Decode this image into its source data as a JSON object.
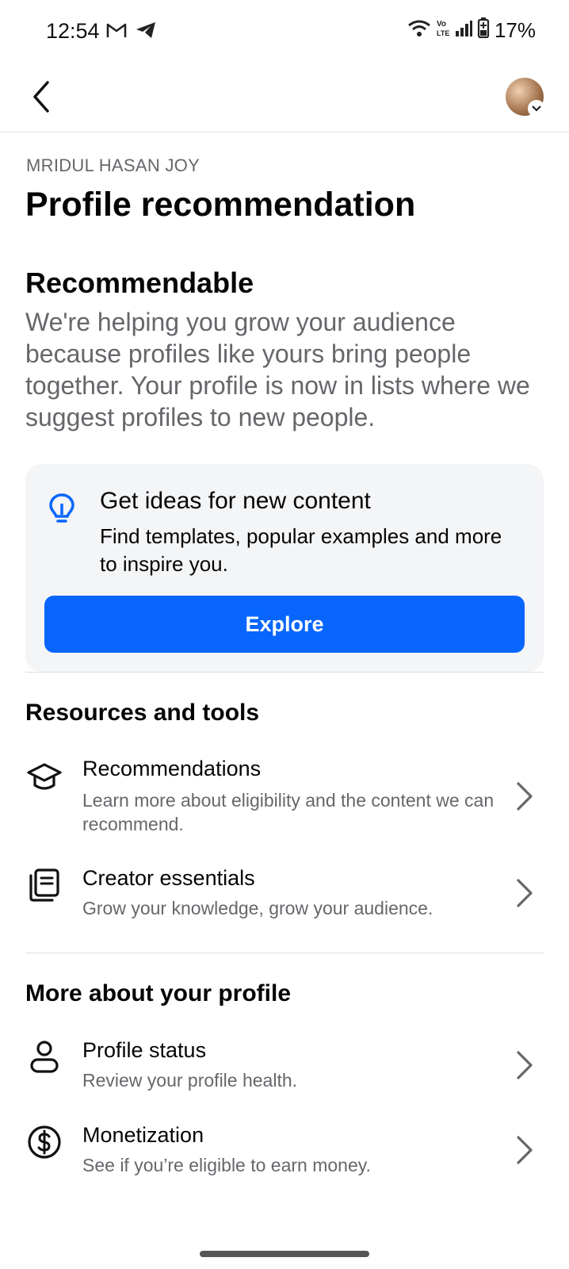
{
  "status_bar": {
    "time": "12:54",
    "battery": "17%",
    "icons": [
      "gmail-icon",
      "telegram-icon",
      "wifi-icon",
      "volte-icon",
      "signal-icon",
      "battery-icon"
    ]
  },
  "header": {
    "back_icon": "chevron-left-icon",
    "avatar_icon": "profile-avatar"
  },
  "page": {
    "owner_name": "MRIDUL HASAN JOY",
    "title": "Profile recommendation"
  },
  "recommendable": {
    "heading": "Recommendable",
    "body": "We're helping you grow your audience because profiles like yours bring people together. Your profile is now in lists where we suggest profiles to new people."
  },
  "ideas_card": {
    "icon": "lightbulb-icon",
    "title": "Get ideas for new content",
    "description": "Find templates, popular examples and more to inspire you.",
    "button_label": "Explore"
  },
  "resources": {
    "heading": "Resources and tools",
    "items": [
      {
        "icon": "graduation-cap-icon",
        "title": "Recommendations",
        "description": "Learn more about eligibility and the content we can recommend."
      },
      {
        "icon": "notebook-icon",
        "title": "Creator essentials",
        "description": "Grow your knowledge, grow your audience."
      }
    ]
  },
  "more_profile": {
    "heading": "More about your profile",
    "items": [
      {
        "icon": "person-icon",
        "title": "Profile status",
        "description": "Review your profile health."
      },
      {
        "icon": "dollar-circle-icon",
        "title": "Monetization",
        "description": "See if you’re eligible to earn money."
      }
    ]
  },
  "colors": {
    "accent": "#0866ff",
    "secondary_text": "#65676b",
    "card_bg": "#f4f5f7"
  }
}
